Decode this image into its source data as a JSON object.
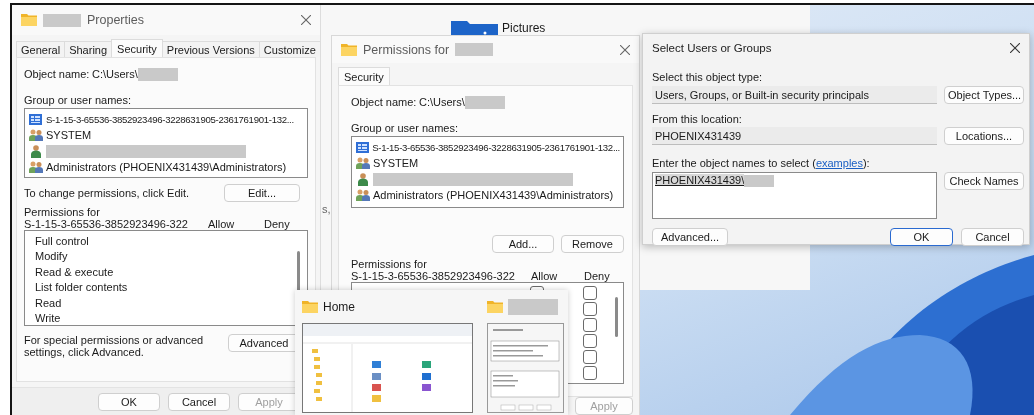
{
  "properties_window": {
    "title": "Properties",
    "tabs": [
      {
        "label": "General",
        "selected": false
      },
      {
        "label": "Sharing",
        "selected": false
      },
      {
        "label": "Security",
        "selected": true
      },
      {
        "label": "Previous Versions",
        "selected": false
      },
      {
        "label": "Customize",
        "selected": false
      }
    ],
    "object_name_label": "Object name:",
    "object_name_value": "C:\\Users\\",
    "group_label": "Group or user names:",
    "principals": [
      {
        "kind": "app-package",
        "name": "S-1-15-3-65536-3852923496-3228631905-2361761901-132..."
      },
      {
        "kind": "group",
        "name": "SYSTEM"
      },
      {
        "kind": "user"
      },
      {
        "kind": "group",
        "name": "Administrators (PHOENIX431439\\Administrators)"
      }
    ],
    "edit_hint": "To change permissions, click Edit.",
    "edit_button": "Edit...",
    "permissions_for_label": "Permissions for",
    "permissions_for_sid": "S-1-15-3-65536-3852923496-322",
    "allow_header": "Allow",
    "deny_header": "Deny",
    "permissions": [
      "Full control",
      "Modify",
      "Read & execute",
      "List folder contents",
      "Read",
      "Write"
    ],
    "advanced_hint": "For special permissions or advanced settings, click Advanced.",
    "advanced_button": "Advanced",
    "buttons": [
      {
        "label": "OK",
        "disabled": false
      },
      {
        "label": "Cancel",
        "disabled": false
      },
      {
        "label": "Apply",
        "disabled": true
      }
    ]
  },
  "explorer_window": {
    "item": "Pictures",
    "edge_text": "s,"
  },
  "permissions_window": {
    "title": "Permissions for",
    "tabs": [
      {
        "label": "Security",
        "selected": true
      }
    ],
    "object_name_label": "Object name:",
    "object_name_value": "C:\\Users\\",
    "group_label": "Group or user names:",
    "principals": [
      {
        "kind": "app-package",
        "name": "S-1-15-3-65536-3852923496-3228631905-2361761901-132..."
      },
      {
        "kind": "group",
        "name": "SYSTEM"
      },
      {
        "kind": "user"
      },
      {
        "kind": "group",
        "name": "Administrators (PHOENIX431439\\Administrators)"
      }
    ],
    "add_button": "Add...",
    "remove_button": "Remove",
    "permissions_for_label": "Permissions for",
    "permissions_for_sid": "S-1-15-3-65536-3852923496-322",
    "allow_header": "Allow",
    "deny_header": "Deny",
    "permission_rows": [
      {
        "allow_checked": false,
        "deny_checked": false
      },
      {
        "deny_checked": false
      },
      {
        "deny_checked": false
      },
      {
        "deny_checked": false
      },
      {
        "deny_checked": false
      },
      {
        "deny_checked": false
      }
    ],
    "buttons": [
      {
        "label": "Apply",
        "disabled": true
      }
    ]
  },
  "select_dialog": {
    "title": "Select Users or Groups",
    "object_type_label": "Select this object type:",
    "object_type_value": "Users, Groups, or Built-in security principals",
    "object_types_button": "Object Types...",
    "location_label": "From this location:",
    "location_value": "PHOENIX431439",
    "locations_button": "Locations...",
    "names_label_before": "Enter the object names to select (",
    "names_label_link": "examples",
    "names_label_after": "):",
    "names_value": "PHOENIX431439\\",
    "check_names_button": "Check Names",
    "buttons": [
      {
        "label": "Advanced...",
        "default": false
      },
      {
        "label": "OK",
        "default": true
      },
      {
        "label": "Cancel",
        "default": false
      }
    ]
  },
  "taskbar_preview": {
    "items": [
      {
        "title": "Home",
        "kind": "explorer"
      },
      {
        "kind": "dialog"
      }
    ]
  }
}
